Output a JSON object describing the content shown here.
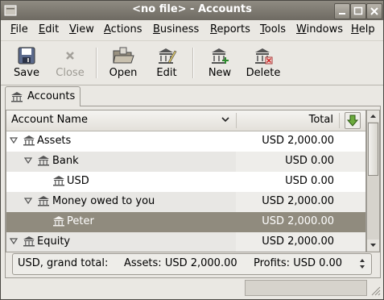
{
  "window": {
    "title": "<no file> - Accounts"
  },
  "menubar": [
    {
      "label": "File",
      "mnemonic": "F",
      "rest": "ile"
    },
    {
      "label": "Edit",
      "mnemonic": "E",
      "rest": "dit"
    },
    {
      "label": "View",
      "mnemonic": "V",
      "rest": "iew"
    },
    {
      "label": "Actions",
      "mnemonic": "A",
      "rest": "ctions"
    },
    {
      "label": "Business",
      "mnemonic": "B",
      "rest": "usiness"
    },
    {
      "label": "Reports",
      "mnemonic": "R",
      "rest": "eports"
    },
    {
      "label": "Tools",
      "mnemonic": "T",
      "rest": "ools"
    },
    {
      "label": "Windows",
      "mnemonic": "W",
      "rest": "indows"
    },
    {
      "label": "Help",
      "mnemonic": "H",
      "rest": "elp"
    }
  ],
  "toolbar": {
    "save": "Save",
    "close": "Close",
    "open": "Open",
    "edit": "Edit",
    "new": "New",
    "delete": "Delete"
  },
  "tab": {
    "label": "Accounts"
  },
  "tree": {
    "columns": {
      "name": "Account Name",
      "total": "Total"
    },
    "rows": [
      {
        "name": "Assets",
        "total": "USD 2,000.00",
        "expanded": true
      },
      {
        "name": "Bank",
        "total": "USD 0.00",
        "expanded": true
      },
      {
        "name": "USD",
        "total": "USD 0.00"
      },
      {
        "name": "Money owed to you",
        "total": "USD 2,000.00",
        "expanded": true
      },
      {
        "name": "Peter",
        "total": "USD 2,000.00",
        "selected": true
      },
      {
        "name": "Equity",
        "total": "USD 2,000.00",
        "expanded": true
      }
    ]
  },
  "summary": {
    "label": "USD, grand total:",
    "assets": "Assets: USD 2,000.00",
    "profits": "Profits: USD 0.00"
  },
  "colors": {
    "selection": "#908b7e",
    "titlebar": "#7e7a71"
  }
}
